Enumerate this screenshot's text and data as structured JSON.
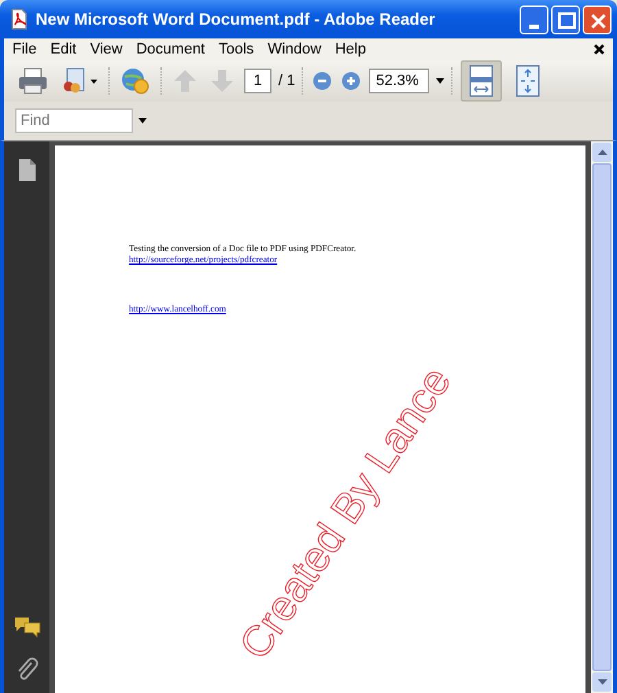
{
  "window": {
    "title": "New Microsoft Word Document.pdf - Adobe Reader"
  },
  "menu": [
    "File",
    "Edit",
    "View",
    "Document",
    "Tools",
    "Window",
    "Help"
  ],
  "toolbar": {
    "previous_page": {
      "disabled": true
    },
    "next_page": {
      "disabled": true
    },
    "page_number": "1",
    "page_total": "/ 1",
    "zoom": "52.3%",
    "view_modes": [
      {
        "kind": "fit-width",
        "selected": true
      },
      {
        "kind": "fit-page",
        "selected": false
      }
    ]
  },
  "find": {
    "placeholder": "Find"
  },
  "document": {
    "lines": [
      {
        "kind": "text",
        "text": "Testing the conversion of a Doc file to PDF using PDFCreator."
      },
      {
        "kind": "link",
        "text": "http://sourceforge.net/projects/pdfcreator"
      },
      {
        "kind": "gap"
      },
      {
        "kind": "link",
        "text": "http://www.lancelhoff.com"
      }
    ],
    "stamp": "Created By Lance"
  }
}
